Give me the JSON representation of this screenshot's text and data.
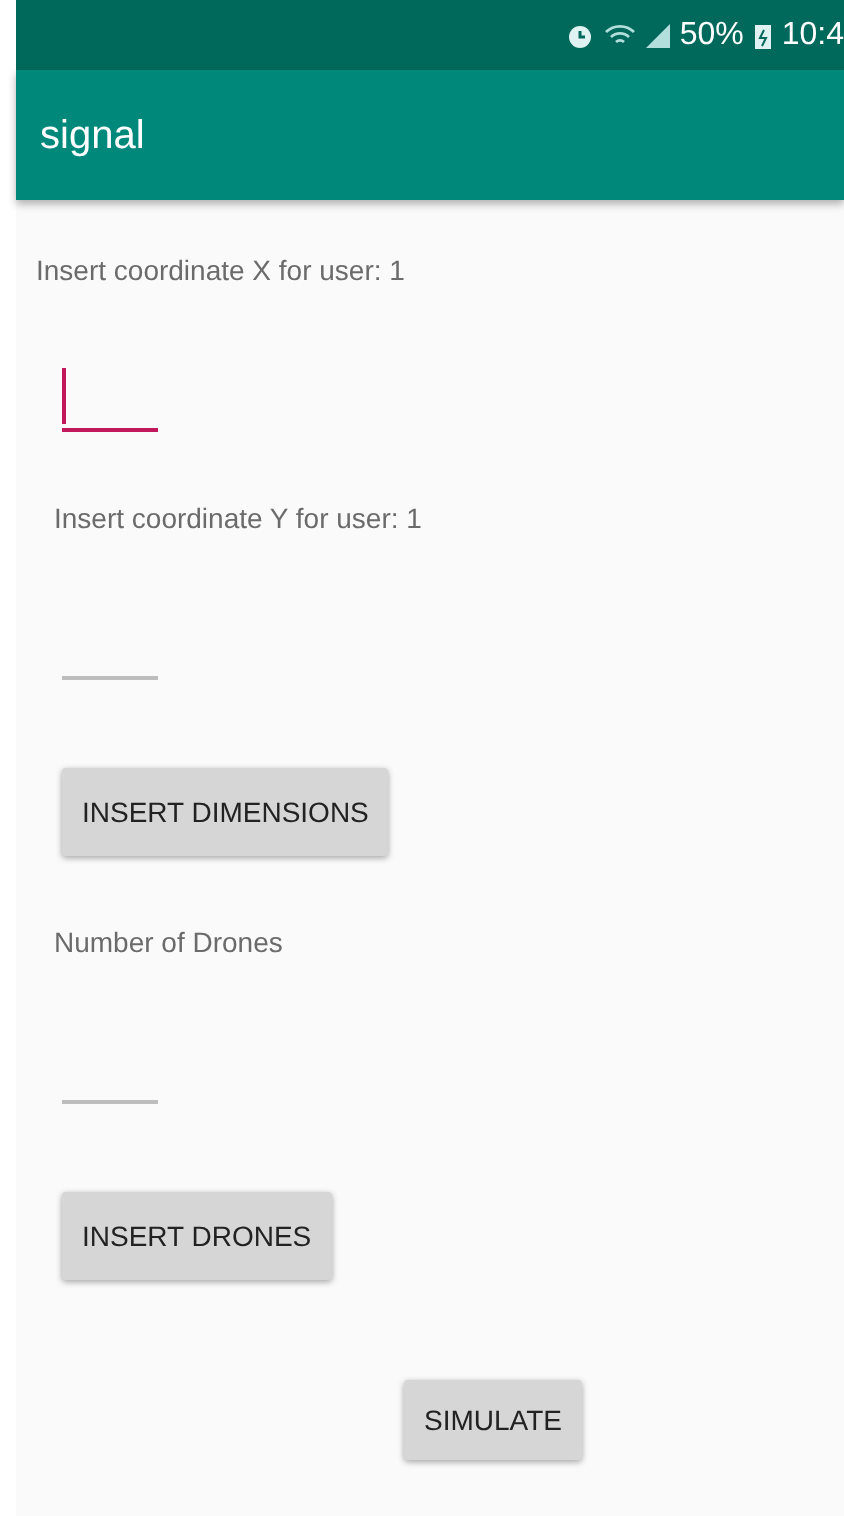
{
  "status_bar": {
    "battery": "50%",
    "time": "10:4"
  },
  "app_bar": {
    "title": "signal"
  },
  "form": [
    {
      "kind": "label",
      "text": "Insert coordinate X for user: 1"
    },
    {
      "kind": "field",
      "focused": true
    },
    {
      "kind": "label",
      "text": "Insert coordinate Y for user: 1"
    },
    {
      "kind": "field",
      "focused": false
    },
    {
      "kind": "button",
      "text": "INSERT DIMENSIONS"
    },
    {
      "kind": "label",
      "text": "Number of Drones"
    },
    {
      "kind": "field",
      "focused": false
    },
    {
      "kind": "button",
      "text": "INSERT DRONES"
    },
    {
      "kind": "center-button",
      "text": "SIMULATE"
    }
  ]
}
